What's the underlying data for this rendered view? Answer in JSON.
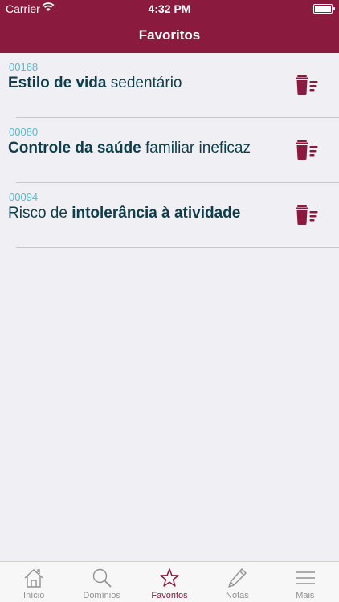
{
  "status": {
    "carrier": "Carrier",
    "time": "4:32 PM"
  },
  "nav": {
    "title": "Favoritos"
  },
  "favorites": [
    {
      "code": "00168",
      "bold": "Estilo de vida",
      "rest": " sedentário",
      "bold_first": true
    },
    {
      "code": "00080",
      "bold": "Controle da saúde",
      "rest": " familiar ineficaz",
      "bold_first": true
    },
    {
      "code": "00094",
      "pre": "Risco de ",
      "bold": "intolerância à atividade",
      "bold_first": false
    }
  ],
  "tabs": [
    {
      "label": "Início",
      "icon": "home-icon"
    },
    {
      "label": "Domínios",
      "icon": "search-icon"
    },
    {
      "label": "Favoritos",
      "icon": "star-icon",
      "active": true
    },
    {
      "label": "Notas",
      "icon": "pencil-icon"
    },
    {
      "label": "Mais",
      "icon": "menu-icon"
    }
  ],
  "colors": {
    "brand": "#8a1b3e",
    "code": "#5ab9c8",
    "title": "#0e3e4b",
    "background": "#efeff4"
  }
}
